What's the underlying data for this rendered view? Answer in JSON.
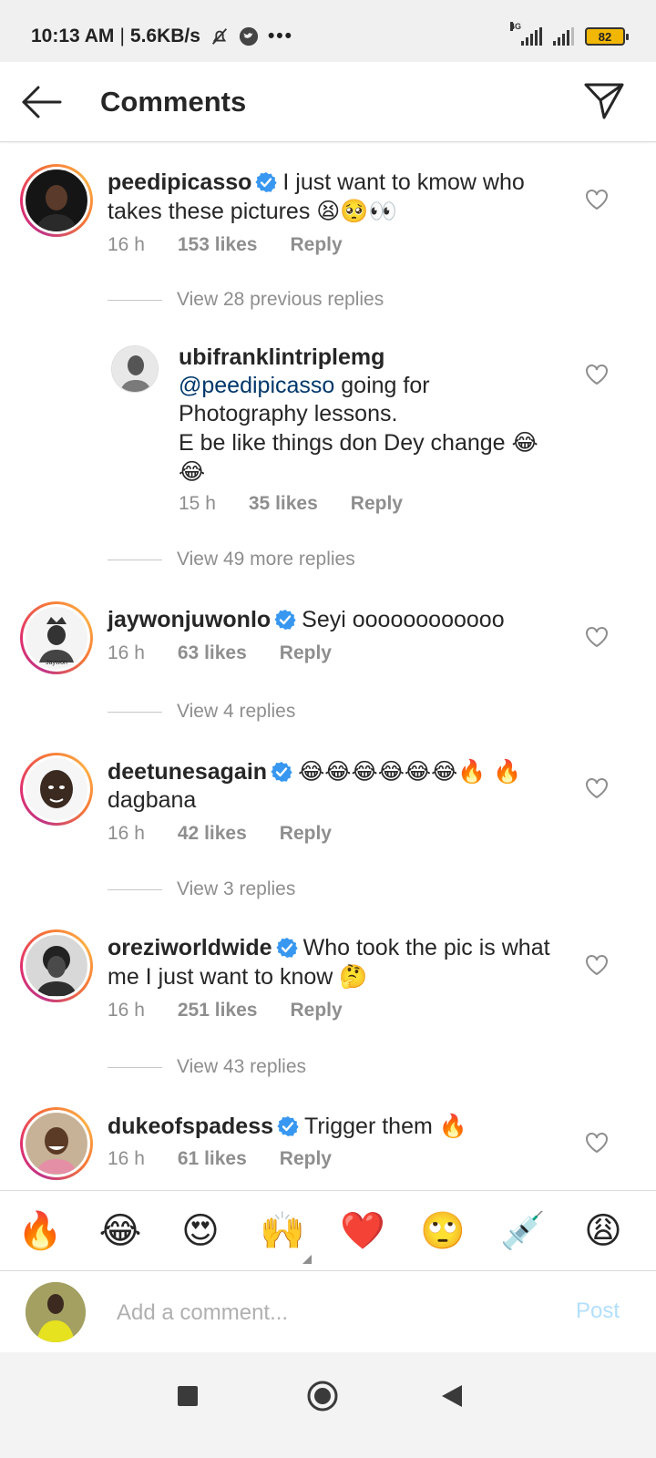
{
  "status_bar": {
    "time": "10:13 AM",
    "separator": "|",
    "speed": "5.6KB/s",
    "network_tag": "4G",
    "battery": "82"
  },
  "header": {
    "title": "Comments"
  },
  "comments": [
    {
      "username": "peedipicasso",
      "verified": true,
      "text": "I just want to kmow who takes these pictures",
      "emoji": "😫🥺👀",
      "time": "16 h",
      "likes": "153 likes",
      "reply": "Reply"
    },
    {
      "view_label": "View 28 previous replies"
    },
    {
      "username": "ubifranklintriplemg",
      "mention": "@peedipicasso",
      "text_line1": "going for",
      "text_line2": "Photography lessons.",
      "text_line3": "E be like things don Dey change",
      "emoji": "😂",
      "emoji2": "😂",
      "time": "15 h",
      "likes": "35 likes",
      "reply": "Reply"
    },
    {
      "view_label": "View 49 more replies"
    },
    {
      "username": "jaywonjuwonlo",
      "verified": true,
      "text": "Seyi oooooooooooo",
      "time": "16 h",
      "likes": "63 likes",
      "reply": "Reply"
    },
    {
      "view_label": "View 4 replies"
    },
    {
      "username": "deetunesagain",
      "verified": true,
      "emoji": "😂😂😂😂😂😂🔥 🔥",
      "text": "dagbana",
      "time": "16 h",
      "likes": "42 likes",
      "reply": "Reply"
    },
    {
      "view_label": "View 3 replies"
    },
    {
      "username": "oreziworldwide",
      "verified": true,
      "text": "Who took the pic is what me I just want to know",
      "emoji": "🤔",
      "time": "16 h",
      "likes": "251 likes",
      "reply": "Reply"
    },
    {
      "view_label": "View 43 replies"
    },
    {
      "username": "dukeofspadess",
      "verified": true,
      "text": "Trigger them",
      "emoji": "🔥",
      "time": "16 h",
      "likes": "61 likes",
      "reply": "Reply"
    }
  ],
  "emoji_bar": [
    "🔥",
    "😂",
    "😍",
    "🙌",
    "❤️",
    "🙄",
    "💉",
    "😩"
  ],
  "composer": {
    "placeholder": "Add a comment...",
    "post_label": "Post"
  },
  "colors": {
    "verified": "#3897f0",
    "post_disabled": "#b2dffc",
    "muted_text": "#8e8e8e",
    "mention": "#00376b"
  }
}
